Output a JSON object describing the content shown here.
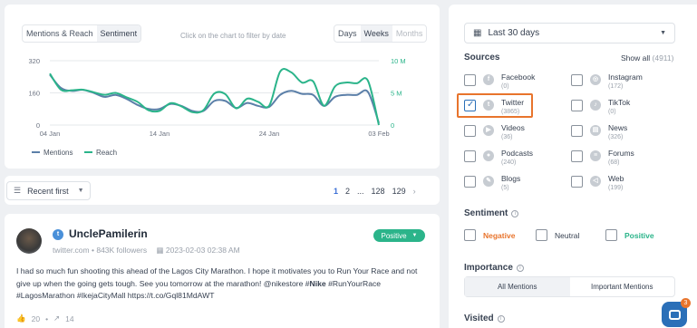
{
  "chart_panel": {
    "tabs": [
      "Mentions & Reach",
      "Sentiment"
    ],
    "hint": "Click on the chart to filter by date",
    "period_tabs": [
      "Days",
      "Weeks",
      "Months"
    ]
  },
  "chart_data": {
    "type": "line",
    "x": [
      "04 Jan",
      "05 Jan",
      "06 Jan",
      "07 Jan",
      "08 Jan",
      "09 Jan",
      "10 Jan",
      "11 Jan",
      "12 Jan",
      "13 Jan",
      "14 Jan",
      "15 Jan",
      "16 Jan",
      "17 Jan",
      "18 Jan",
      "19 Jan",
      "20 Jan",
      "21 Jan",
      "22 Jan",
      "23 Jan",
      "24 Jan",
      "25 Jan",
      "26 Jan",
      "27 Jan",
      "28 Jan",
      "29 Jan",
      "30 Jan",
      "31 Jan",
      "01 Feb",
      "02 Feb",
      "03 Feb"
    ],
    "x_tick_labels": [
      "04 Jan",
      "14 Jan",
      "24 Jan",
      "03 Feb"
    ],
    "y_left_ticks": [
      "320",
      "160",
      "0"
    ],
    "y_right_ticks": [
      "10 M",
      "5 M",
      "0"
    ],
    "series": [
      {
        "name": "Mentions",
        "axis": "left",
        "color": "#5b7fa8",
        "values": [
          250,
          185,
          170,
          175,
          160,
          140,
          150,
          130,
          100,
          80,
          80,
          105,
          95,
          70,
          70,
          120,
          120,
          85,
          110,
          95,
          90,
          150,
          170,
          155,
          150,
          95,
          140,
          150,
          150,
          165,
          10
        ]
      },
      {
        "name": "Reach",
        "axis": "right",
        "color": "#2bb48a",
        "values": [
          8.0,
          5.5,
          5.4,
          5.5,
          5.1,
          4.7,
          5.0,
          4.3,
          3.6,
          2.3,
          2.2,
          3.4,
          2.9,
          2.0,
          2.3,
          4.9,
          4.8,
          2.6,
          4.1,
          3.6,
          3.0,
          8.3,
          8.2,
          6.6,
          6.8,
          3.0,
          6.0,
          6.6,
          6.5,
          6.9,
          0.0
        ]
      }
    ],
    "ylim_left": [
      0,
      320
    ],
    "ylim_right": [
      0,
      10
    ],
    "legend": "bottom-left"
  },
  "sort": {
    "label": "Recent first"
  },
  "pagination": {
    "pages": [
      "1",
      "2",
      "...",
      "128",
      "129"
    ],
    "current": "1"
  },
  "mention": {
    "author": "UnclePamilerin",
    "domain": "twitter.com",
    "followers": "843K followers",
    "date": "2023-02-03 02:38 AM",
    "sentiment": "Positive",
    "text_pre": "I had so much fun shooting this ahead of the Lagos City Marathon. I hope it motivates you to Run Your Race and not give up when the going gets tough. See you tomorrow at the marathon! @nikestore #",
    "text_bold": "Nike",
    "text_post": " #RunYourRace #LagosMarathon #IkejaCityMall https://t.co/Gql81MdAWT",
    "likes": "20",
    "shares": "14"
  },
  "filters": {
    "date_range": "Last 30 days",
    "sources_title": "Sources",
    "show_all": "Show all",
    "total": "(4911)",
    "sources": [
      {
        "name": "Facebook",
        "count": "(0)",
        "icon": "facebook-icon",
        "glyph": "f",
        "checked": false
      },
      {
        "name": "Instagram",
        "count": "(172)",
        "icon": "instagram-icon",
        "glyph": "◎",
        "checked": false
      },
      {
        "name": "Twitter",
        "count": "(3865)",
        "icon": "twitter-icon",
        "glyph": "t",
        "checked": true
      },
      {
        "name": "TikTok",
        "count": "(0)",
        "icon": "tiktok-icon",
        "glyph": "♪",
        "checked": false
      },
      {
        "name": "Videos",
        "count": "(36)",
        "icon": "video-icon",
        "glyph": "▶",
        "checked": false
      },
      {
        "name": "News",
        "count": "(326)",
        "icon": "news-icon",
        "glyph": "▤",
        "checked": false
      },
      {
        "name": "Podcasts",
        "count": "(240)",
        "icon": "podcast-icon",
        "glyph": "●",
        "checked": false
      },
      {
        "name": "Forums",
        "count": "(68)",
        "icon": "forum-icon",
        "glyph": "≡",
        "checked": false
      },
      {
        "name": "Blogs",
        "count": "(5)",
        "icon": "blog-icon",
        "glyph": "✎",
        "checked": false
      },
      {
        "name": "Web",
        "count": "(199)",
        "icon": "web-icon",
        "glyph": "◁",
        "checked": false
      }
    ],
    "sentiment_title": "Sentiment",
    "sentiments": [
      {
        "label": "Negative",
        "color": "#e8742c"
      },
      {
        "label": "Neutral",
        "color": "#374151"
      },
      {
        "label": "Positive",
        "color": "#2bb48a"
      }
    ],
    "importance_title": "Importance",
    "importance_tabs": [
      "All Mentions",
      "Important Mentions"
    ],
    "visited_title": "Visited"
  },
  "chat": {
    "badge": "3"
  },
  "colors": {
    "accent": "#2bb48a",
    "highlight": "#e8742c",
    "link": "#3b6fd6"
  }
}
